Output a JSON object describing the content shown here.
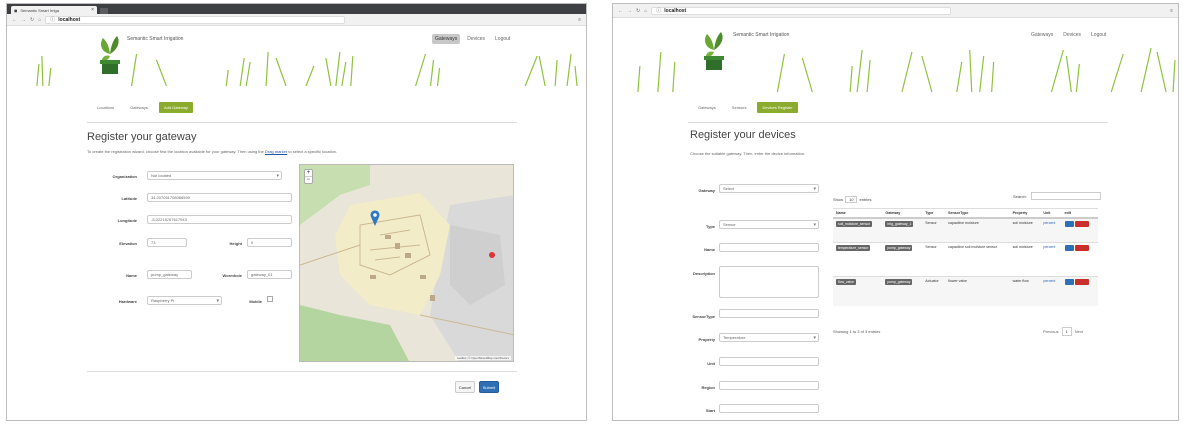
{
  "left": {
    "tab_title": "Semantic Smart Irriga",
    "url_host": "localhost",
    "app_title": "Semantic Smart Irrigation",
    "topnav": [
      "Gateways",
      "Devices",
      "Logout"
    ],
    "subnav": [
      "Locations",
      "Gateways",
      "Add Gateway"
    ],
    "heading": "Register your gateway",
    "subline_pre": "To create the registration wizard, choose first the location available for your gateway. Then using the",
    "subline_link": "Drag marker",
    "subline_post": "to select a specific location.",
    "form": {
      "organization_label": "Organization",
      "organization_value": "Not located",
      "latitude_label": "Latitude",
      "latitude_value": "34.207051708066590",
      "longitude_label": "Longitude",
      "longitude_value": "-5.02215767617043",
      "elevation_label": "Elevation",
      "elevation_value": "73",
      "height_label": "Height",
      "height_value": "0",
      "name_label": "Name",
      "name_value": "pump_gateway",
      "wormhole_label": "Wormhole",
      "wormhole_value": "gateway_01",
      "hardware_label": "Hardware",
      "hardware_value": "Raspberry Pi",
      "mobile_label": "Mobile"
    },
    "map_zoom_in": "+",
    "map_zoom_out": "−",
    "map_attribution": "Leaflet | © OpenStreetMap contributors",
    "buttons": {
      "cancel": "Cancel",
      "submit": "Submit"
    }
  },
  "right": {
    "url_host": "localhost",
    "app_title": "Semantic Smart Irrigation",
    "topnav": [
      "Gateways",
      "Devices",
      "Logout"
    ],
    "subnav": [
      "Gateways",
      "Sensors",
      "Devices Register"
    ],
    "heading": "Register your devices",
    "subline": "Choose the suitable gateway. Then, enter the device information.",
    "form_labels": [
      "Gateway",
      "Type",
      "Name",
      "Description",
      "SensorType",
      "Property",
      "Unit",
      "Region",
      "Start"
    ],
    "gateway_placeholder": "Select",
    "type_value": "Sensor",
    "property_value": "Temperature",
    "show_label": "Show",
    "show_value": "10",
    "entries_label": "entries",
    "search_label": "Search:",
    "table": {
      "headers": [
        "Name",
        "Gateway",
        "Type",
        "SensorType",
        "Property",
        "Unit",
        "edit"
      ],
      "rows": [
        {
          "name": "soil_moisture_sensor",
          "gateway": "irrig_gateway_1",
          "type": "Sensor",
          "sensortype": "capacitive moisture",
          "property": "soil moisture",
          "unit": "percent"
        },
        {
          "name": "temperature_sensor",
          "gateway": "pump_gateway",
          "type": "Sensor",
          "sensortype": "capacitive soil moisture sensor",
          "property": "soil moisture",
          "unit": "percent"
        },
        {
          "name": "flow_valve",
          "gateway": "pump_gateway",
          "type": "Actuator",
          "sensortype": "flower valve",
          "property": "water flow",
          "unit": "percent"
        }
      ],
      "edit_label": "Edit",
      "delete_label": "Delete"
    },
    "showing": "Showing 1 to 3 of 3 entries",
    "pager": {
      "prev": "Previous",
      "page": "1",
      "next": "Next"
    }
  }
}
